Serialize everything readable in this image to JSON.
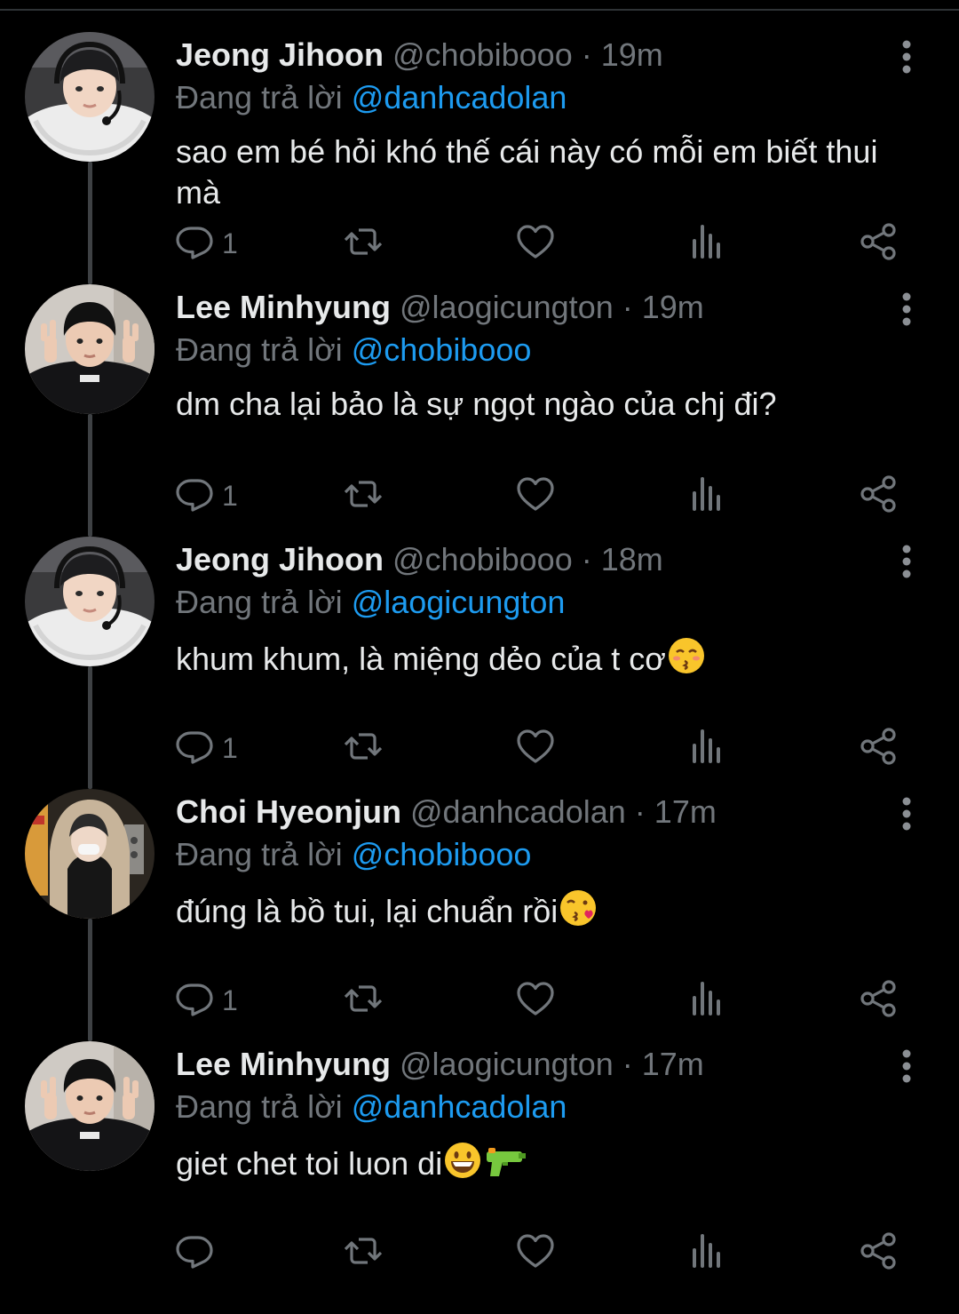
{
  "tweets": [
    {
      "name": "Jeong Jihoon",
      "handle": "@chobibooo",
      "separator": "·",
      "time": "19m",
      "reply_prefix": "Đang trả lời",
      "reply_to": "@danhcadolan",
      "text": "sao em bé hỏi khó thế cái này có mỗi em biết thui mà",
      "emojis": [],
      "reply_count": "1",
      "avatar": "person-with-headset-white-hoodie"
    },
    {
      "name": "Lee Minhyung",
      "handle": "@laogicungton",
      "separator": "·",
      "time": "19m",
      "reply_prefix": "Đang trả lời",
      "reply_to": "@chobibooo",
      "text": "dm cha lại bảo là sự ngọt ngào của chj đi?",
      "emojis": [],
      "reply_count": "1",
      "avatar": "person-black-jacket-peace-signs"
    },
    {
      "name": "Jeong Jihoon",
      "handle": "@chobibooo",
      "separator": "·",
      "time": "18m",
      "reply_prefix": "Đang trả lời",
      "reply_to": "@laogicungton",
      "text": "khum khum, là miệng dẻo của t cơ",
      "emojis": [
        "kissing-smiling-eyes-emoji"
      ],
      "reply_count": "1",
      "avatar": "person-with-headset-white-hoodie"
    },
    {
      "name": "Choi Hyeonjun",
      "handle": "@danhcadolan",
      "separator": "·",
      "time": "17m",
      "reply_prefix": "Đang trả lời",
      "reply_to": "@chobibooo",
      "text": "đúng là bồ tui, lại chuẩn rồi",
      "emojis": [
        "face-blowing-kiss-emoji"
      ],
      "reply_count": "1",
      "avatar": "person-beige-hooded-coat"
    },
    {
      "name": "Lee Minhyung",
      "handle": "@laogicungton",
      "separator": "·",
      "time": "17m",
      "reply_prefix": "Đang trả lời",
      "reply_to": "@danhcadolan",
      "text": "giet chet toi luon di",
      "emojis": [
        "grinning-face-emoji",
        "water-pistol-emoji"
      ],
      "reply_count": "",
      "avatar": "person-black-jacket-peace-signs"
    }
  ],
  "icons": {
    "reply": "speech-bubble-icon",
    "retweet": "retweet-arrows-icon",
    "like": "heart-icon",
    "views": "bar-chart-icon",
    "share": "share-nodes-icon",
    "more": "vertical-ellipsis-icon"
  },
  "colors": {
    "background": "#000000",
    "text": "#e7e9ea",
    "muted": "#71767b",
    "link": "#1d9bf0",
    "thread_line": "#3e4144"
  }
}
